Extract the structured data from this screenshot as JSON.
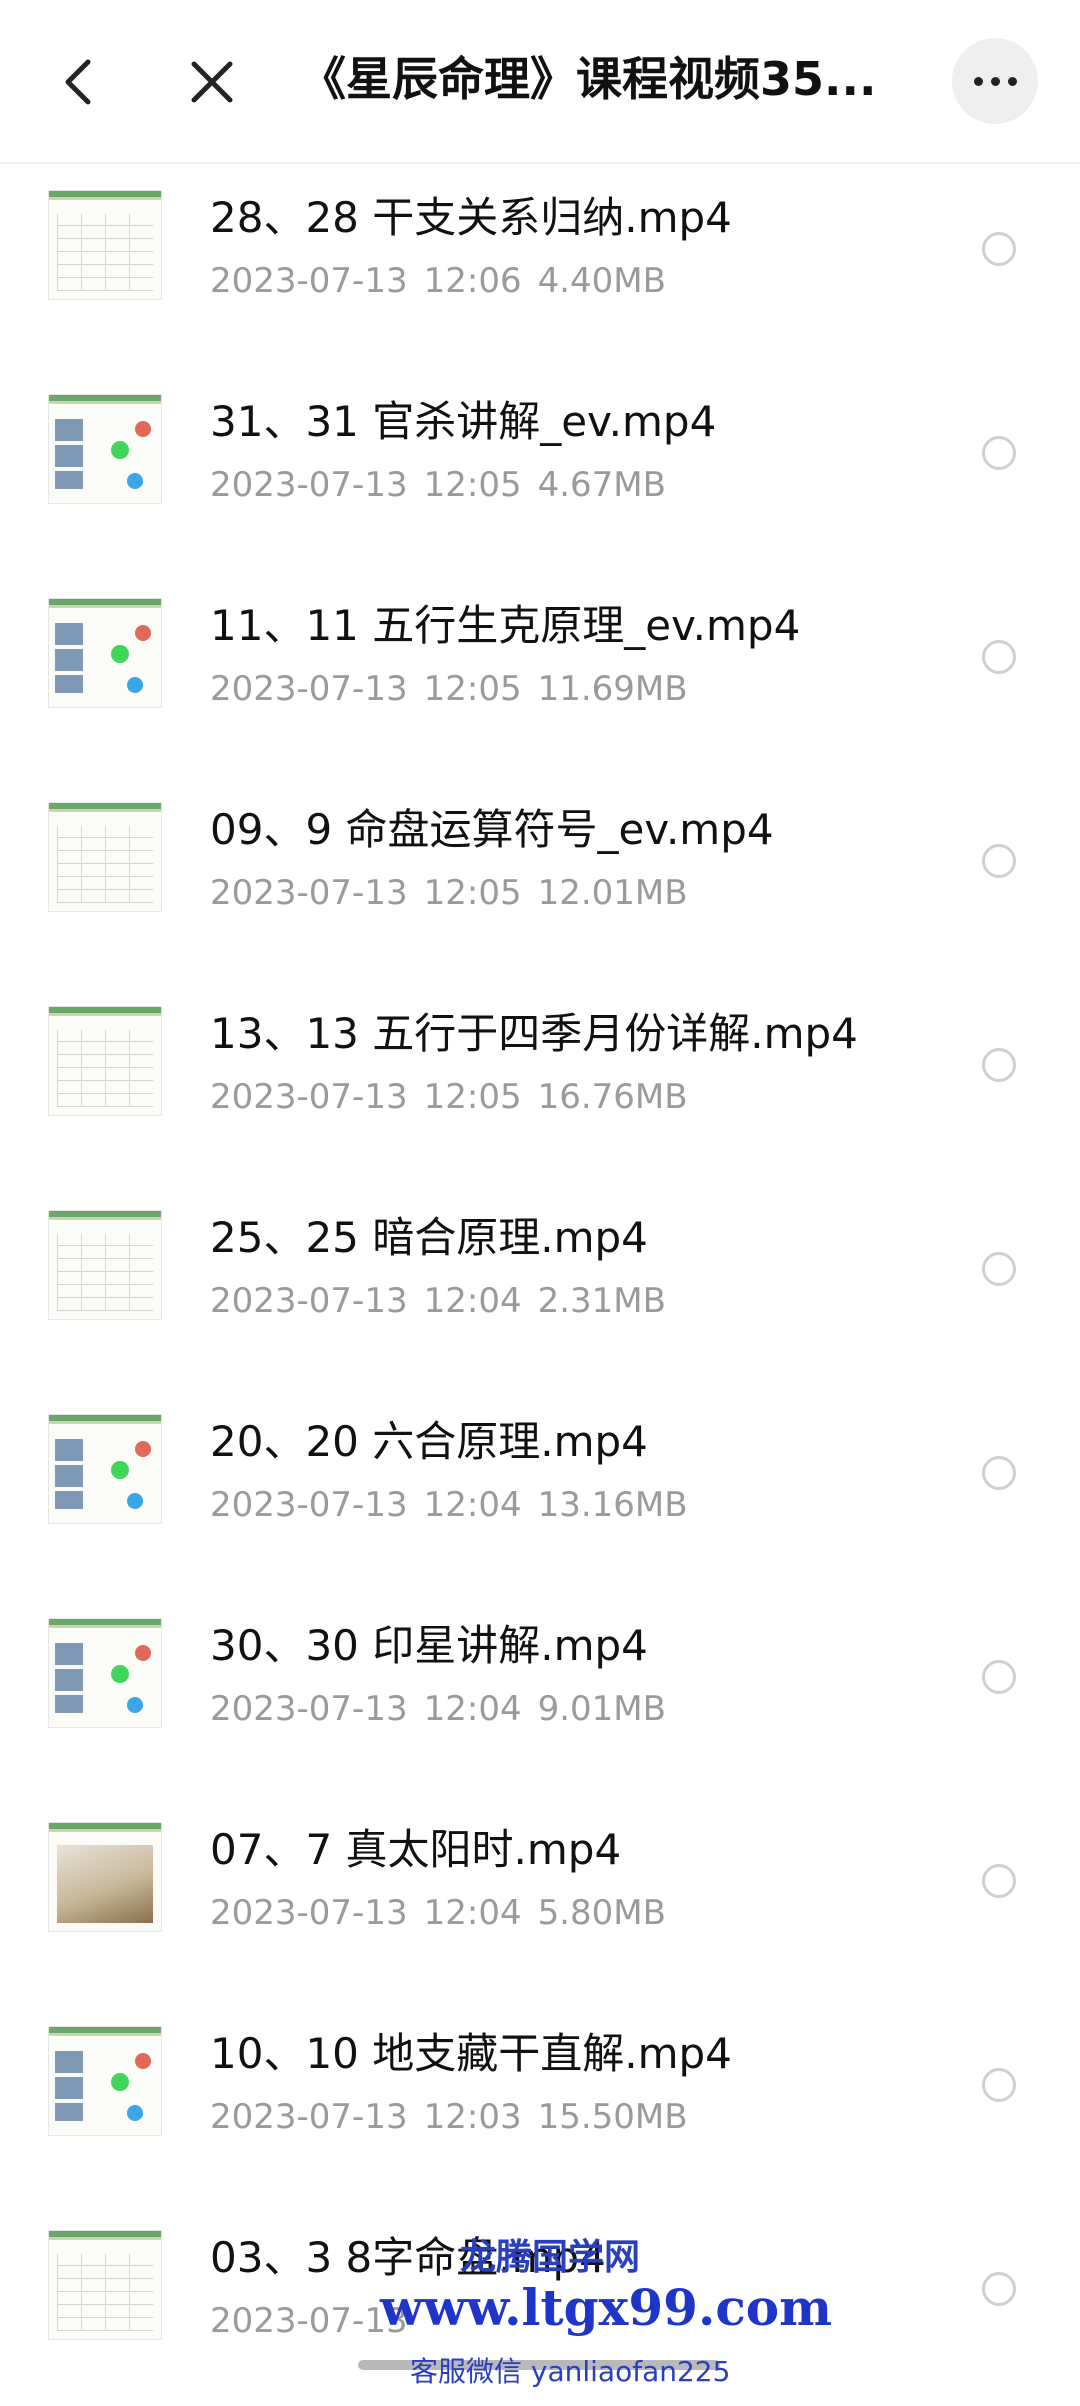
{
  "header": {
    "title": "《星辰命理》课程视频35...",
    "back_icon": "chevron-left-icon",
    "close_icon": "close-icon",
    "more_icon": "more-horizontal-icon"
  },
  "files": [
    {
      "name": "28、28 干支关系归纳.mp4",
      "date": "2023-07-13",
      "time": "12:06",
      "size": "4.40MB"
    },
    {
      "name": "31、31 官杀讲解_ev.mp4",
      "date": "2023-07-13",
      "time": "12:05",
      "size": "4.67MB"
    },
    {
      "name": "11、11 五行生克原理_ev.mp4",
      "date": "2023-07-13",
      "time": "12:05",
      "size": "11.69MB"
    },
    {
      "name": "09、9 命盘运算符号_ev.mp4",
      "date": "2023-07-13",
      "time": "12:05",
      "size": "12.01MB"
    },
    {
      "name": "13、13 五行于四季月份详解.mp4",
      "date": "2023-07-13",
      "time": "12:05",
      "size": "16.76MB"
    },
    {
      "name": "25、25 暗合原理.mp4",
      "date": "2023-07-13",
      "time": "12:04",
      "size": "2.31MB"
    },
    {
      "name": "20、20 六合原理.mp4",
      "date": "2023-07-13",
      "time": "12:04",
      "size": "13.16MB"
    },
    {
      "name": "30、30 印星讲解.mp4",
      "date": "2023-07-13",
      "time": "12:04",
      "size": "9.01MB"
    },
    {
      "name": "07、7 真太阳时.mp4",
      "date": "2023-07-13",
      "time": "12:04",
      "size": "5.80MB"
    },
    {
      "name": "10、10 地支藏干直解.mp4",
      "date": "2023-07-13",
      "time": "12:03",
      "size": "15.50MB"
    },
    {
      "name": "03、3 8字命盘.mp4",
      "date": "2023-07-13",
      "time": "",
      "size": ""
    }
  ],
  "watermark": {
    "line1": "龙腾国学网",
    "line2": "www.ltgx99.com",
    "line3": "客服微信 yanliaofan225"
  }
}
